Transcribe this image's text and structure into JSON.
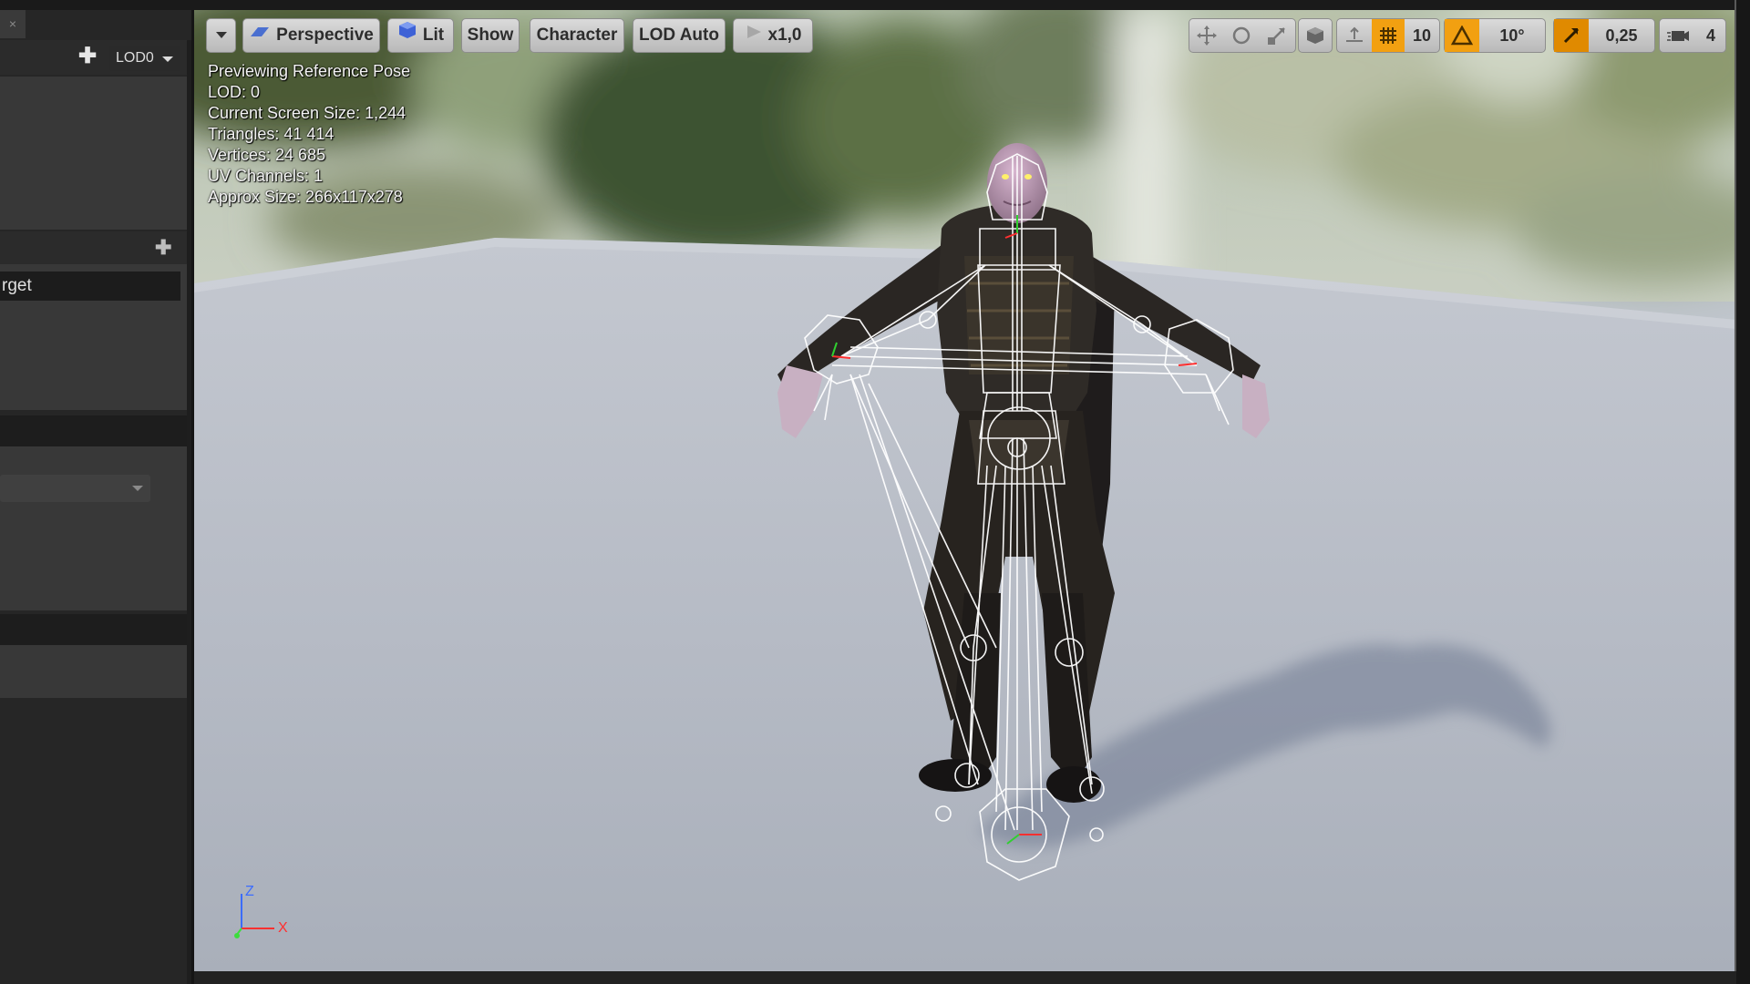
{
  "left_panel": {
    "tab_close": "×",
    "lod_dropdown": "LOD0",
    "add_icon": "plus-icon",
    "target_field": "rget"
  },
  "toolbar": {
    "menu_icon": "chevron-down-icon",
    "perspective": "Perspective",
    "lit": "Lit",
    "show": "Show",
    "character": "Character",
    "lod": "LOD Auto",
    "play_speed": "x1,0",
    "grid_snap_value": "10",
    "rotation_snap_value": "10°",
    "scale_snap_value": "0,25",
    "camera_speed_value": "4",
    "icons": [
      "translate-icon",
      "rotate-icon",
      "scale-icon",
      "world-local-icon",
      "surface-snap-icon",
      "grid-snap-icon",
      "rotation-snap-icon",
      "scale-snap-icon",
      "camera-speed-icon"
    ]
  },
  "stats": {
    "line1": "Previewing Reference Pose",
    "line2": "LOD: 0",
    "line3": "Current Screen Size: 1,244",
    "line4": "Triangles: 41 414",
    "line5": "Vertices: 24 685",
    "line6": "UV Channels: 1",
    "line7": "Approx Size: 266x117x278"
  },
  "axis": {
    "z": "Z",
    "x": "X"
  },
  "colors": {
    "accent_orange": "#f2a011",
    "panel_bg": "#262626",
    "axis_z": "#3b6cff",
    "axis_x": "#ff3030",
    "axis_y": "#3cdc3c"
  }
}
